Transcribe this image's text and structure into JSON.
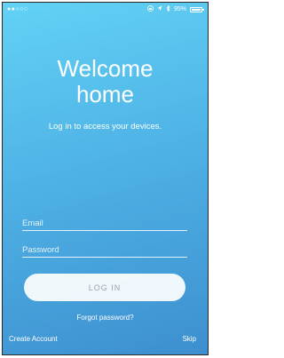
{
  "status_bar": {
    "carrier_dots": "●●○○○",
    "icons": [
      "screen-lock-icon",
      "location-arrow-icon",
      "bluetooth-icon"
    ],
    "battery_text": "95%",
    "battery_level": 0.95
  },
  "welcome": {
    "title_line1": "Welcome",
    "title_line2": "home",
    "subtitle": "Log in to access your devices."
  },
  "form": {
    "email_placeholder": "Email",
    "password_placeholder": "Password",
    "login_label": "LOG IN"
  },
  "links": {
    "forgot": "Forgot password?",
    "create_account": "Create Account",
    "skip": "Skip"
  },
  "colors": {
    "gradient_top": "#62d2f5",
    "gradient_bottom": "#3d8fcf",
    "button_bg": "#ffffff",
    "button_text": "#9aa4ad"
  }
}
